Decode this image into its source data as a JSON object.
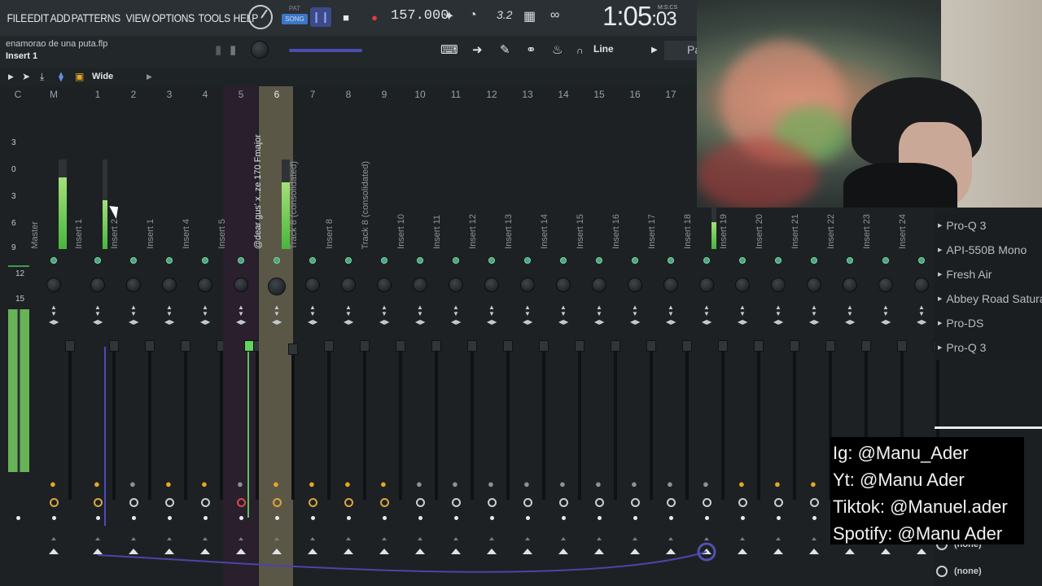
{
  "menu": [
    "FILE",
    "EDIT",
    "ADD",
    "PATTERNS",
    "VIEW",
    "OPTIONS",
    "TOOLS",
    "HELP"
  ],
  "transport": {
    "pat_label": "PAT",
    "song_label": "SONG",
    "tempo": "157.000",
    "time_main": "1:05",
    "time_small": ":03",
    "time_format": "M:S:CS",
    "step_label": "3.2"
  },
  "project": {
    "file_name": "enamorao de una puta.flp",
    "insert_name": "Insert 1",
    "snap_mode": "Line",
    "panel_label": "Pa"
  },
  "mixer_toolbar": {
    "view_mode": "Wide"
  },
  "mixer": {
    "header_labels": [
      "C",
      "M",
      "1",
      "2",
      "3",
      "4",
      "5",
      "6",
      "7",
      "8",
      "9",
      "10",
      "11",
      "12",
      "13",
      "14",
      "15",
      "16",
      "17"
    ],
    "scale": [
      "3",
      "0",
      "3",
      "6",
      "9",
      "12",
      "15"
    ],
    "tracks": [
      {
        "name": "Master",
        "level": 0.8
      },
      {
        "name": "Insert 1",
        "level": 0.55
      },
      {
        "name": "Insert 2",
        "level": 0.0
      },
      {
        "name": "Insert 1",
        "level": 0.0
      },
      {
        "name": "Insert 4",
        "level": 0.0
      },
      {
        "name": "Insert 5",
        "level": 0.0
      },
      {
        "name": "@dear gus' x..ze 170 Fmajor",
        "level": 0.75
      },
      {
        "name": "Track 8 (consolidated)",
        "level": 0.0
      },
      {
        "name": "Insert 8",
        "level": 0.0
      },
      {
        "name": "Track 8 (consolidated)",
        "level": 0.0
      },
      {
        "name": "Insert 10",
        "level": 0.0
      },
      {
        "name": "Insert 11",
        "level": 0.0
      },
      {
        "name": "Insert 12",
        "level": 0.0
      },
      {
        "name": "Insert 13",
        "level": 0.0
      },
      {
        "name": "Insert 14",
        "level": 0.0
      },
      {
        "name": "Insert 15",
        "level": 0.0
      },
      {
        "name": "Insert 16",
        "level": 0.0
      },
      {
        "name": "Insert 17",
        "level": 0.0
      },
      {
        "name": "Insert 18",
        "level": 0.3
      },
      {
        "name": "Insert 19",
        "level": 0.0
      },
      {
        "name": "Insert 20",
        "level": 0.0
      },
      {
        "name": "Insert 21",
        "level": 0.0
      },
      {
        "name": "Insert 22",
        "level": 0.0
      },
      {
        "name": "Insert 23",
        "level": 0.0
      },
      {
        "name": "Insert 24",
        "level": 0.0
      }
    ]
  },
  "plugins": [
    "Pro-Q 3",
    "API-550B Mono",
    "Fresh Air",
    "Abbey Road Satura",
    "Pro-DS",
    "Pro-Q 3"
  ],
  "outputs": [
    "(none)",
    "(none)"
  ],
  "social": {
    "ig": "Ig: @Manu_Ader",
    "yt": "Yt: @Manu Ader",
    "tiktok": "Tiktok: @Manuel.ader",
    "spotify": "Spotify: @Manu Ader"
  },
  "colors": {
    "selected_strip": "#5b5746",
    "meter_green": "#47b63d",
    "accent_blue": "#3d76c7",
    "send_orange": "#e5a726"
  }
}
